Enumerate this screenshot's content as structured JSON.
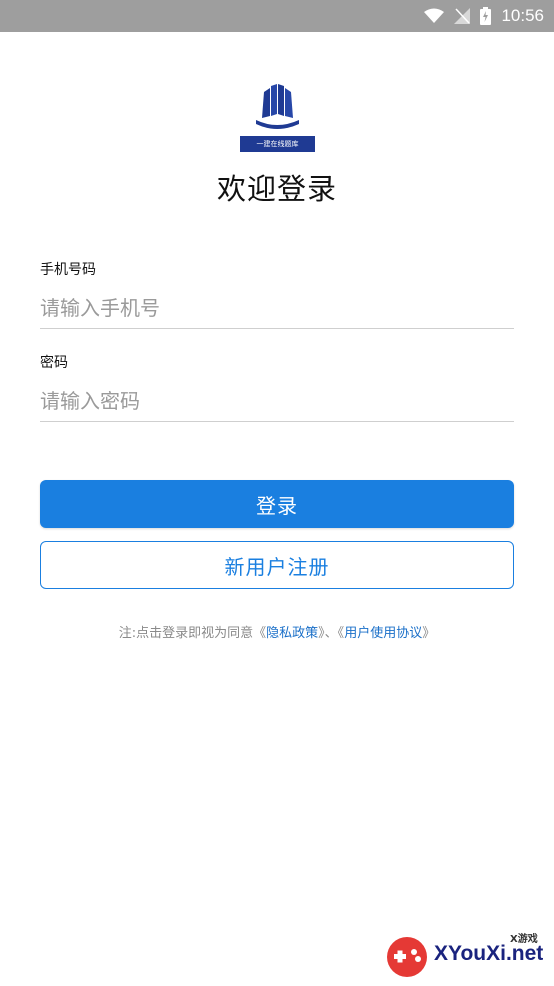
{
  "status_bar": {
    "time": "10:56"
  },
  "logo": {
    "band_text": "一建在线题库"
  },
  "welcome_title": "欢迎登录",
  "phone": {
    "label": "手机号码",
    "placeholder": "请输入手机号"
  },
  "password": {
    "label": "密码",
    "placeholder": "请输入密码"
  },
  "buttons": {
    "login": "登录",
    "register": "新用户注册"
  },
  "agreement": {
    "prefix": "注:点击登录即视为同意《",
    "privacy": "隐私政策",
    "middle": "》、《",
    "terms": "用户使用协议",
    "suffix": "》"
  },
  "watermark": {
    "brand": "XYouXi.net",
    "small": "X游戏"
  },
  "colors": {
    "primary": "#1a7fe0",
    "status_bar": "#9e9e9e",
    "logo": "#1f3a93"
  }
}
